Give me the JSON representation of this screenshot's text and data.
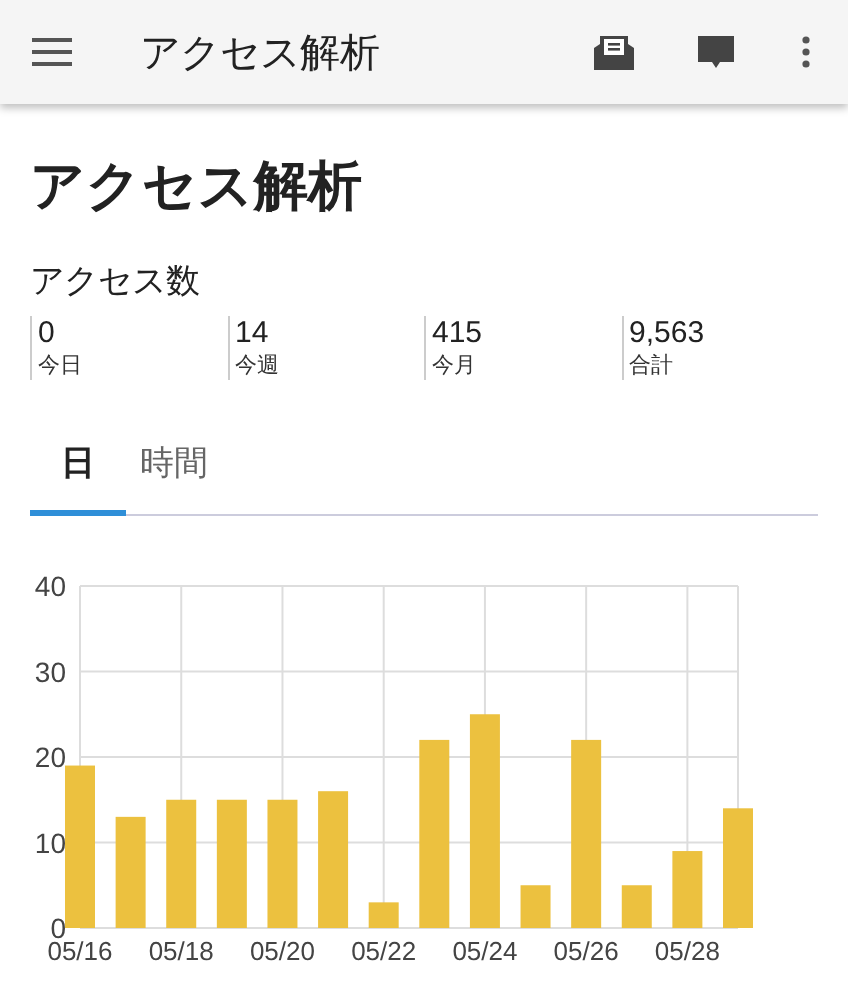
{
  "app_bar": {
    "title": "アクセス解析"
  },
  "heading": "アクセス解析",
  "access": {
    "label": "アクセス数",
    "stats": [
      {
        "value": "0",
        "label": "今日"
      },
      {
        "value": "14",
        "label": "今週"
      },
      {
        "value": "415",
        "label": "今月"
      },
      {
        "value": "9,563",
        "label": "合計"
      }
    ]
  },
  "tabs": [
    {
      "label": "日",
      "selected": true
    },
    {
      "label": "時間",
      "selected": false
    }
  ],
  "chart_data": {
    "type": "bar",
    "categories": [
      "05/16",
      null,
      "05/18",
      null,
      "05/20",
      null,
      "05/22",
      null,
      "05/24",
      null,
      "05/26",
      null,
      "05/28",
      null
    ],
    "series": [
      {
        "color": "#ecc13f",
        "values": [
          19,
          13,
          15,
          15,
          15,
          16,
          3,
          22,
          25,
          5,
          22,
          5,
          9,
          14
        ]
      }
    ],
    "grid": true,
    "ylim": [
      0,
      40
    ],
    "yticks": [
      0,
      10,
      20,
      30,
      40
    ]
  }
}
